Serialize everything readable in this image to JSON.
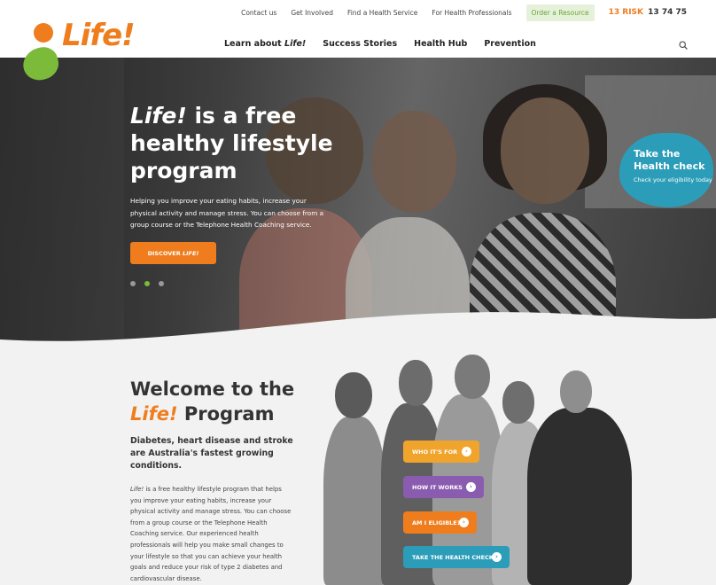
{
  "header": {
    "logo_text": "Life!",
    "top_links": [
      "Contact us",
      "Get Involved",
      "Find a Health Service",
      "For Health Professionals"
    ],
    "order_button": "Order a Resource",
    "phone_risk": "13 RISK",
    "phone_number": "13 74 75",
    "nav": {
      "learn_prefix": "Learn about ",
      "learn_life": "Life!",
      "success": "Success Stories",
      "hub": "Health Hub",
      "prevention": "Prevention"
    }
  },
  "hero": {
    "title_life": "Life!",
    "title_rest": " is a free healthy lifestyle program",
    "description": "Helping you improve your eating habits, increase your physical activity and manage stress. You can choose from a group course or the Telephone Health Coaching service.",
    "cta_prefix": "DISCOVER ",
    "cta_life": "LIFE!",
    "slides": 3,
    "active_slide": 2
  },
  "health_bubble": {
    "title": "Take the Health check",
    "subtitle": "Check your eligibility today"
  },
  "welcome": {
    "title_1": "Welcome to the",
    "title_life": "Life!",
    "title_2": " Program",
    "subtitle": "Diabetes, heart disease and stroke are Australia's fastest growing conditions.",
    "body_life": "Life!",
    "body": " is a free healthy lifestyle program that helps you improve your eating habits, increase your physical activity and manage stress. You can choose from a group course or the Telephone Health Coaching service. Our experienced health professionals will help you make small changes to your lifestyle so that you can achieve your health goals and reduce your risk of type 2 diabetes and cardiovascular disease."
  },
  "actions": {
    "who": "WHO IT'S FOR",
    "how": "HOW IT WORKS",
    "eligible": "AM I ELIGIBLE?",
    "check": "TAKE THE HEALTH CHECK"
  },
  "colors": {
    "orange": "#ef7d1e",
    "green": "#7cbb3a",
    "yellow": "#f0a42c",
    "purple": "#8a5cb0",
    "teal": "#2b9db8"
  }
}
